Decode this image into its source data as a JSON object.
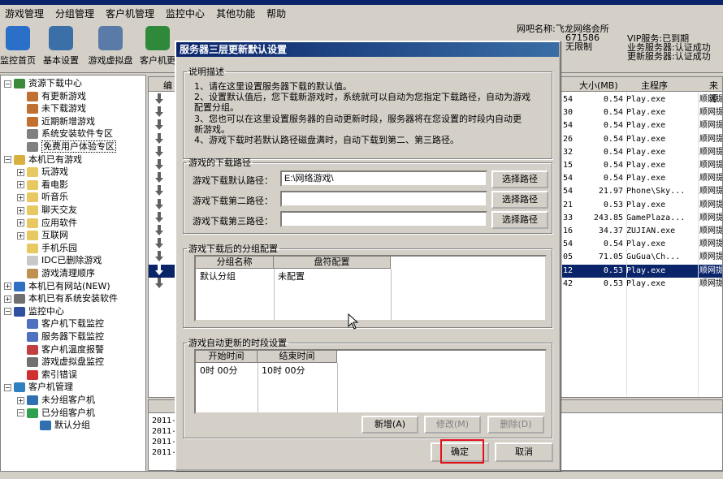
{
  "menu": [
    "游戏管理",
    "分组管理",
    "客户机管理",
    "监控中心",
    "其他功能",
    "帮助"
  ],
  "toolbar": [
    {
      "label": "监控首页",
      "icon": "monitor-icon",
      "color": "#2a6fc8"
    },
    {
      "label": "基本设置",
      "icon": "gear-icon",
      "color": "#3a6fa8"
    },
    {
      "label": "游戏虚拟盘",
      "icon": "disk-icon",
      "color": "#5a7aa8"
    },
    {
      "label": "客户机更",
      "icon": "refresh-icon",
      "color": "#2e8a3a"
    }
  ],
  "netinfo": {
    "l1": "网吧名称:飞龙网络会所",
    "l2": "671586",
    "l3": "无限制"
  },
  "vipinfo": {
    "l1": "VIP服务:已到期",
    "l2": "业务服务器:认证成功",
    "l3": "更新服务器:认证成功"
  },
  "tree": [
    {
      "label": "资源下载中心",
      "indent": 0,
      "pm": "-",
      "icon": "download-center-icon",
      "color": "#3a8a3a"
    },
    {
      "label": "有更新游戏",
      "indent": 1,
      "icon": "update-game-icon",
      "color": "#c07030"
    },
    {
      "label": "未下载游戏",
      "indent": 1,
      "icon": "not-downloaded-icon",
      "color": "#c07030"
    },
    {
      "label": "近期新增游戏",
      "indent": 1,
      "icon": "new-game-icon",
      "color": "#c07030"
    },
    {
      "label": "系统安装软件专区",
      "indent": 1,
      "icon": "software-icon",
      "color": "#808080"
    },
    {
      "label": "免费用户体验专区",
      "indent": 1,
      "icon": "trial-icon",
      "color": "#808080",
      "hover": true
    },
    {
      "label": "本机已有游戏",
      "indent": 0,
      "pm": "-",
      "icon": "folder-icon",
      "color": "#d8b040"
    },
    {
      "label": "玩游戏",
      "indent": 1,
      "pm": "+",
      "icon": "folder-icon",
      "color": "#e8c860"
    },
    {
      "label": "看电影",
      "indent": 1,
      "pm": "+",
      "icon": "folder-icon",
      "color": "#e8c860"
    },
    {
      "label": "听音乐",
      "indent": 1,
      "pm": "+",
      "icon": "folder-icon",
      "color": "#e8c860"
    },
    {
      "label": "聊天交友",
      "indent": 1,
      "pm": "+",
      "icon": "folder-icon",
      "color": "#e8c860"
    },
    {
      "label": "应用软件",
      "indent": 1,
      "pm": "+",
      "icon": "folder-icon",
      "color": "#e8c860"
    },
    {
      "label": "互联网",
      "indent": 1,
      "pm": "+",
      "icon": "folder-icon",
      "color": "#e8c860"
    },
    {
      "label": "手机乐园",
      "indent": 1,
      "icon": "folder-icon",
      "color": "#e8c860"
    },
    {
      "label": "IDC已删除游戏",
      "indent": 1,
      "icon": "deleted-game-icon",
      "color": "#c8c8c8"
    },
    {
      "label": "游戏清理顺序",
      "indent": 1,
      "icon": "broom-icon",
      "color": "#c09050"
    },
    {
      "label": "本机已有网站(NEW)",
      "indent": 0,
      "pm": "+",
      "icon": "globe-icon",
      "color": "#3070c0"
    },
    {
      "label": "本机已有系统安装软件",
      "indent": 0,
      "pm": "+",
      "icon": "system-software-icon",
      "color": "#707070"
    },
    {
      "label": "监控中心",
      "indent": 0,
      "pm": "-",
      "icon": "monitor-center-icon",
      "color": "#3050a0"
    },
    {
      "label": "客户机下载监控",
      "indent": 1,
      "icon": "client-monitor-icon",
      "color": "#5070c0"
    },
    {
      "label": "服务器下载监控",
      "indent": 1,
      "icon": "server-monitor-icon",
      "color": "#5070c0"
    },
    {
      "label": "客户机温度报警",
      "indent": 1,
      "icon": "temperature-icon",
      "color": "#c04040"
    },
    {
      "label": "游戏虚拟盘监控",
      "indent": 1,
      "icon": "virtual-disk-icon",
      "color": "#707070"
    },
    {
      "label": "索引错误",
      "indent": 1,
      "icon": "index-error-icon",
      "color": "#d03030"
    },
    {
      "label": "客户机管理",
      "indent": 0,
      "pm": "-",
      "icon": "client-manage-icon",
      "color": "#3080c0"
    },
    {
      "label": "未分组客户机",
      "indent": 1,
      "pm": "+",
      "icon": "computer-icon",
      "color": "#3070b0"
    },
    {
      "label": "已分组客户机",
      "indent": 1,
      "pm": "-",
      "icon": "computer-icon",
      "color": "#30a050"
    },
    {
      "label": "默认分组",
      "indent": 2,
      "icon": "computer-icon",
      "color": "#3070b0"
    }
  ],
  "list": {
    "headers": {
      "c0": "编",
      "c1": "大小(MB)",
      "c2": "主程序",
      "c3": "来源"
    },
    "rows": [
      {
        "n": "54",
        "size": "0.54",
        "exe": "Play.exe",
        "src": "顺网提"
      },
      {
        "n": "30",
        "size": "0.54",
        "exe": "Play.exe",
        "src": "顺网提"
      },
      {
        "n": "54",
        "size": "0.54",
        "exe": "Play.exe",
        "src": "顺网提"
      },
      {
        "n": "26",
        "size": "0.54",
        "exe": "Play.exe",
        "src": "顺网提"
      },
      {
        "n": "32",
        "size": "0.54",
        "exe": "Play.exe",
        "src": "顺网提"
      },
      {
        "n": "15",
        "size": "0.54",
        "exe": "Play.exe",
        "src": "顺网提"
      },
      {
        "n": "54",
        "size": "0.54",
        "exe": "Play.exe",
        "src": "顺网提"
      },
      {
        "n": "54",
        "size": "21.97",
        "exe": "Phone\\Sky...",
        "src": "顺网提"
      },
      {
        "n": "21",
        "size": "0.53",
        "exe": "Play.exe",
        "src": "顺网提"
      },
      {
        "n": "33",
        "size": "243.85",
        "exe": "GamePlaza...",
        "src": "顺网提"
      },
      {
        "n": "16",
        "size": "34.37",
        "exe": "ZUJIAN.exe",
        "src": "顺网提"
      },
      {
        "n": "54",
        "size": "0.54",
        "exe": "Play.exe",
        "src": "顺网提"
      },
      {
        "n": "05",
        "size": "71.05",
        "exe": "GuGua\\Ch...",
        "src": "顺网提"
      },
      {
        "n": "12",
        "size": "0.53",
        "exe": "Play.exe",
        "src": "顺网提",
        "selected": true
      },
      {
        "n": "42",
        "size": "0.53",
        "exe": "Play.exe",
        "src": "顺网提"
      }
    ]
  },
  "log": [
    "2011-",
    "2011-",
    "2011-",
    "2011-"
  ],
  "dialog": {
    "title": "服务器三层更新默认设置",
    "desc_legend": "说明描述",
    "desc_lines": [
      "1、请在这里设置服务器下载的默认值。",
      "2、设置默认值后，您下载新游戏时，系统就可以自动为您指定下载路径，自动为游戏",
      "配置分组。",
      "3、您也可以在这里设置服务器的自动更新时段，服务器将在您设置的时段内自动更",
      "新游戏。",
      "4、游戏下载时若默认路径磁盘满时，自动下载到第二、第三路径。"
    ],
    "path_legend": "游戏的下载路径",
    "paths": [
      {
        "label": "游戏下载默认路径：",
        "value": "E:\\网络游戏\\",
        "button": "选择路径"
      },
      {
        "label": "游戏下载第二路径：",
        "value": "",
        "button": "选择路径"
      },
      {
        "label": "游戏下载第三路径：",
        "value": "",
        "button": "选择路径"
      }
    ],
    "group_legend": "游戏下载后的分组配置",
    "group_headers": [
      "分组名称",
      "盘符配置"
    ],
    "group_rows": [
      {
        "name": "默认分组",
        "drive": "未配置"
      }
    ],
    "time_legend": "游戏自动更新的时段设置",
    "time_headers": [
      "开始时间",
      "结束时间"
    ],
    "time_rows": [
      {
        "start": "0时 00分",
        "end": "10时 00分"
      }
    ],
    "btn_add": "新增(A)",
    "btn_edit": "修改(M)",
    "btn_delete": "删除(D)",
    "btn_ok": "确定",
    "btn_cancel": "取消"
  },
  "colors": {
    "titlebar": "#0a246a",
    "selection": "#0a246a",
    "highlight": "#e0101a",
    "face": "#d4d0c8"
  }
}
